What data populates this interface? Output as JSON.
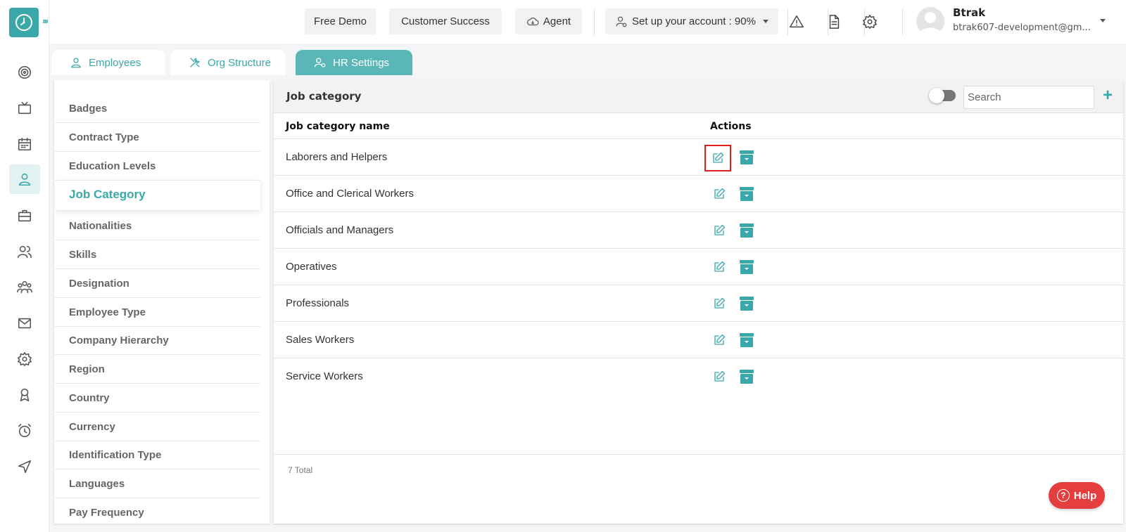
{
  "app": {
    "logo_icon": "clock-logo-icon",
    "brand_color": "#3aa8a8"
  },
  "sidebar": {
    "expand_glyph": "›››",
    "items": [
      {
        "icon": "dashboard-icon"
      },
      {
        "icon": "tv-icon"
      },
      {
        "icon": "calendar-icon"
      },
      {
        "icon": "user-icon",
        "active": true
      },
      {
        "icon": "briefcase-icon"
      },
      {
        "icon": "users-icon"
      },
      {
        "icon": "team-icon"
      },
      {
        "icon": "mail-icon"
      },
      {
        "icon": "settings-icon"
      },
      {
        "icon": "award-icon"
      },
      {
        "icon": "alarm-icon"
      },
      {
        "icon": "send-icon"
      }
    ]
  },
  "topbar": {
    "free_demo": "Free Demo",
    "customer_success": "Customer Success",
    "agent": "Agent",
    "setup": "Set up your account : 90%",
    "user_name": "Btrak",
    "user_email": "btrak607-development@gm..."
  },
  "tabs": [
    {
      "label": "Employees",
      "icon": "person-icon"
    },
    {
      "label": "Org Structure",
      "icon": "tools-icon"
    },
    {
      "label": "HR Settings",
      "icon": "user-settings-icon",
      "active": true
    }
  ],
  "settings_menu": [
    "Badges",
    "Contract Type",
    "Education Levels",
    "Job Category",
    "Nationalities",
    "Skills",
    "Designation",
    "Employee Type",
    "Company Hierarchy",
    "Region",
    "Country",
    "Currency",
    "Identification Type",
    "Languages",
    "Pay Frequency"
  ],
  "settings_active": "Job Category",
  "panel": {
    "title": "Job category",
    "search_placeholder": "Search",
    "add_glyph": "+",
    "columns": {
      "name": "Job category name",
      "actions": "Actions"
    },
    "rows": [
      "Laborers and Helpers",
      "Office and Clerical Workers",
      "Officials and Managers",
      "Operatives",
      "Professionals",
      "Sales Workers",
      "Service Workers"
    ],
    "total": "7 Total"
  },
  "help": {
    "label": "Help",
    "glyph": "?"
  }
}
